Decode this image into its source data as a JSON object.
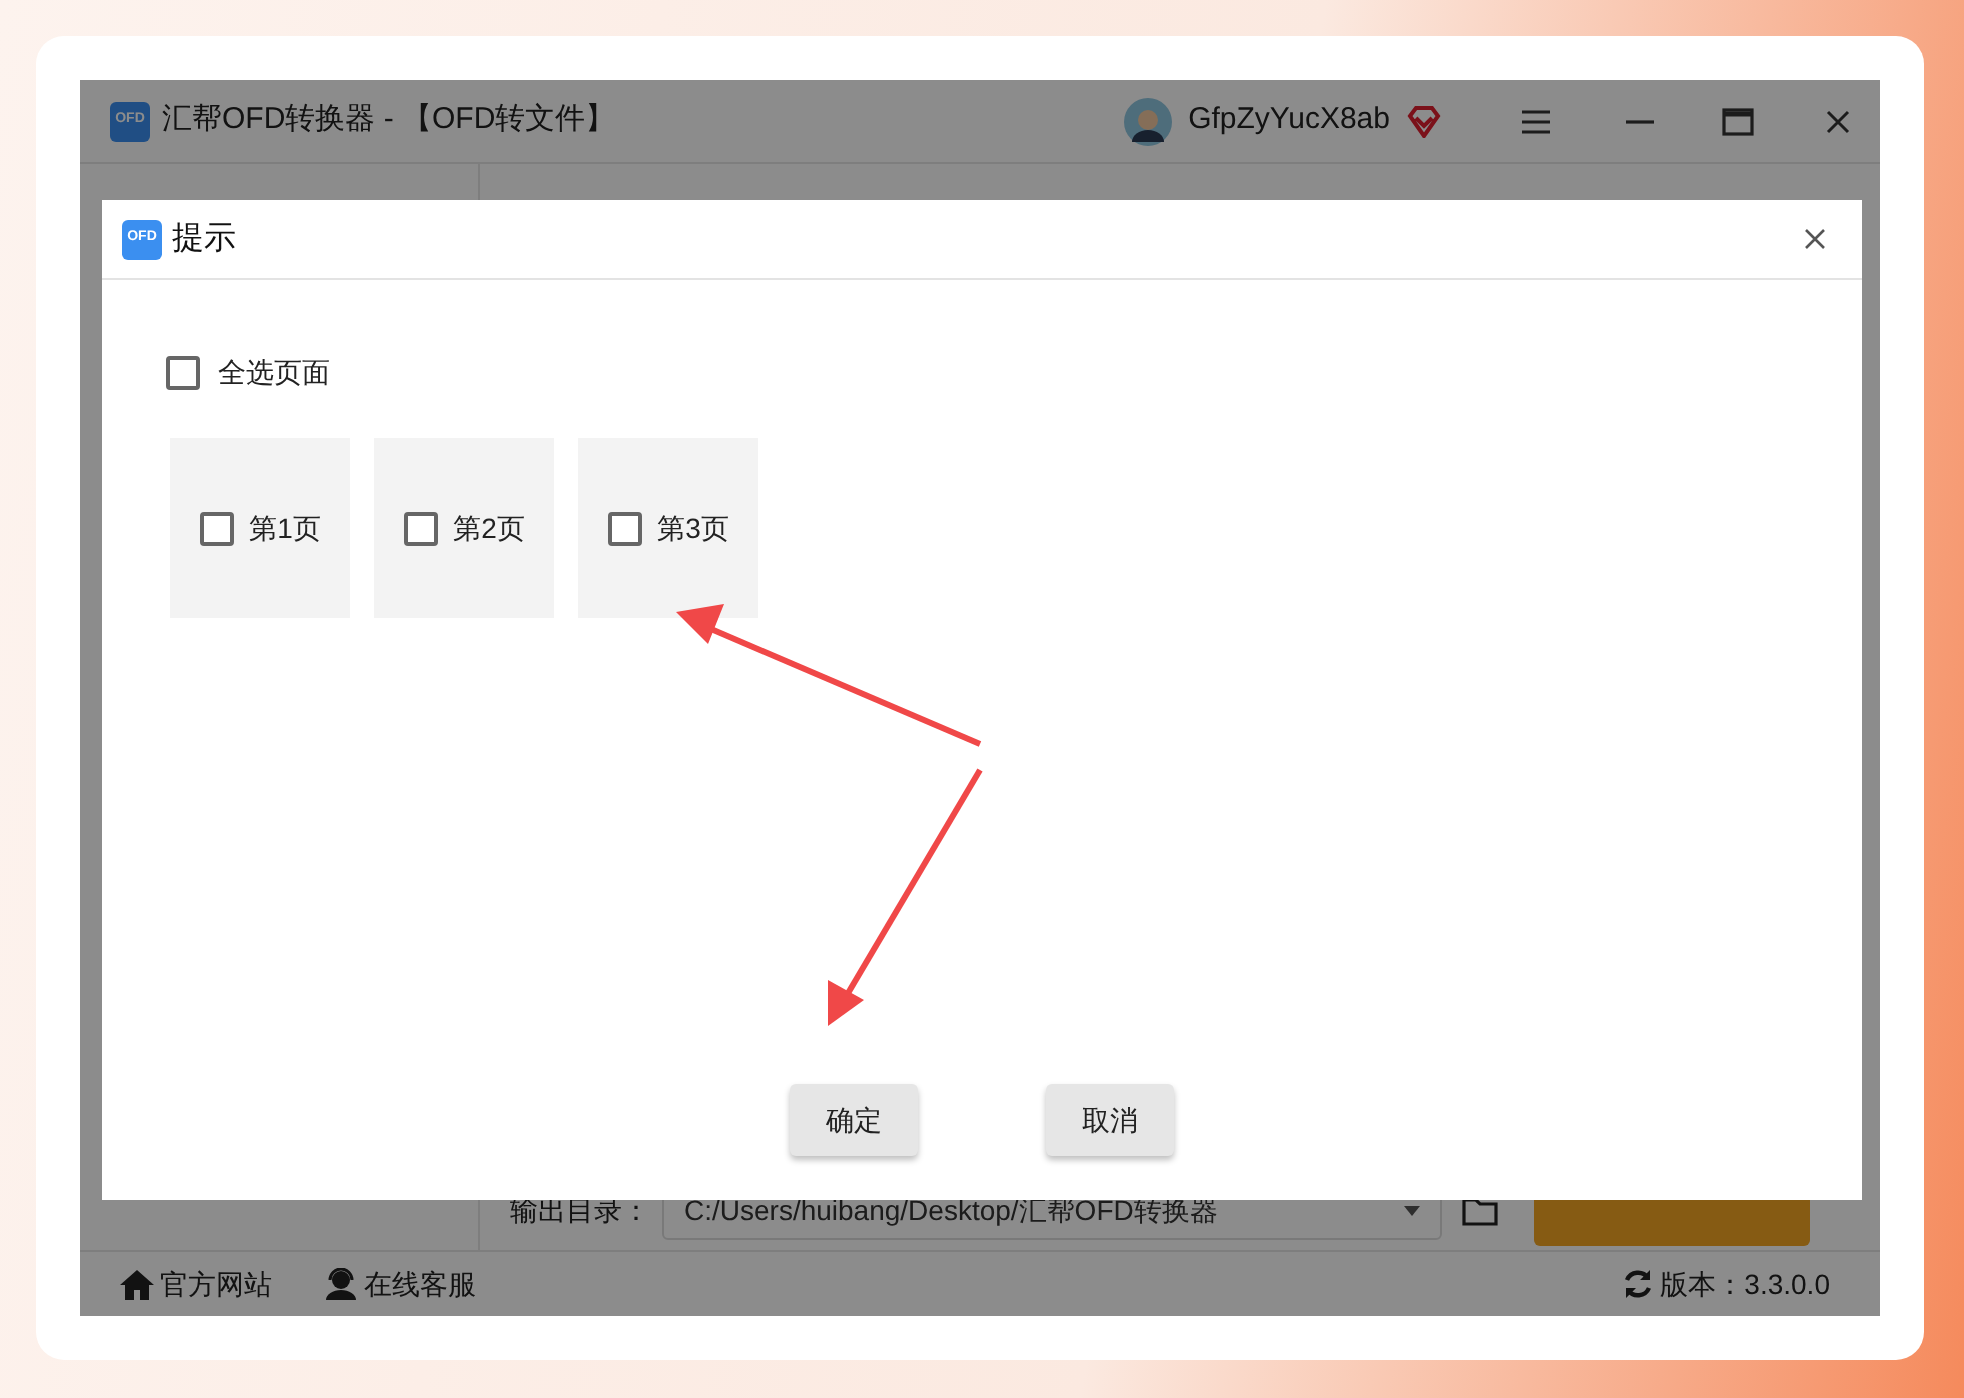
{
  "window": {
    "icon_text": "OFD",
    "title": "汇帮OFD转换器 - 【OFD转文件】",
    "user": "GfpZyYucX8ab"
  },
  "output": {
    "label": "输出目录：",
    "path": "C:/Users/huibang/Desktop/汇帮OFD转换器"
  },
  "status_bar": {
    "links": [
      "官方网站",
      "在线客服"
    ],
    "version": "版本：3.3.0.0"
  },
  "dialog": {
    "icon_text": "OFD",
    "title": "提示",
    "select_all": {
      "label": "全选页面",
      "checked": false
    },
    "pages": [
      {
        "label": "第1页",
        "checked": false
      },
      {
        "label": "第2页",
        "checked": false
      },
      {
        "label": "第3页",
        "checked": false
      }
    ],
    "buttons": [
      "确定",
      "取消"
    ]
  }
}
